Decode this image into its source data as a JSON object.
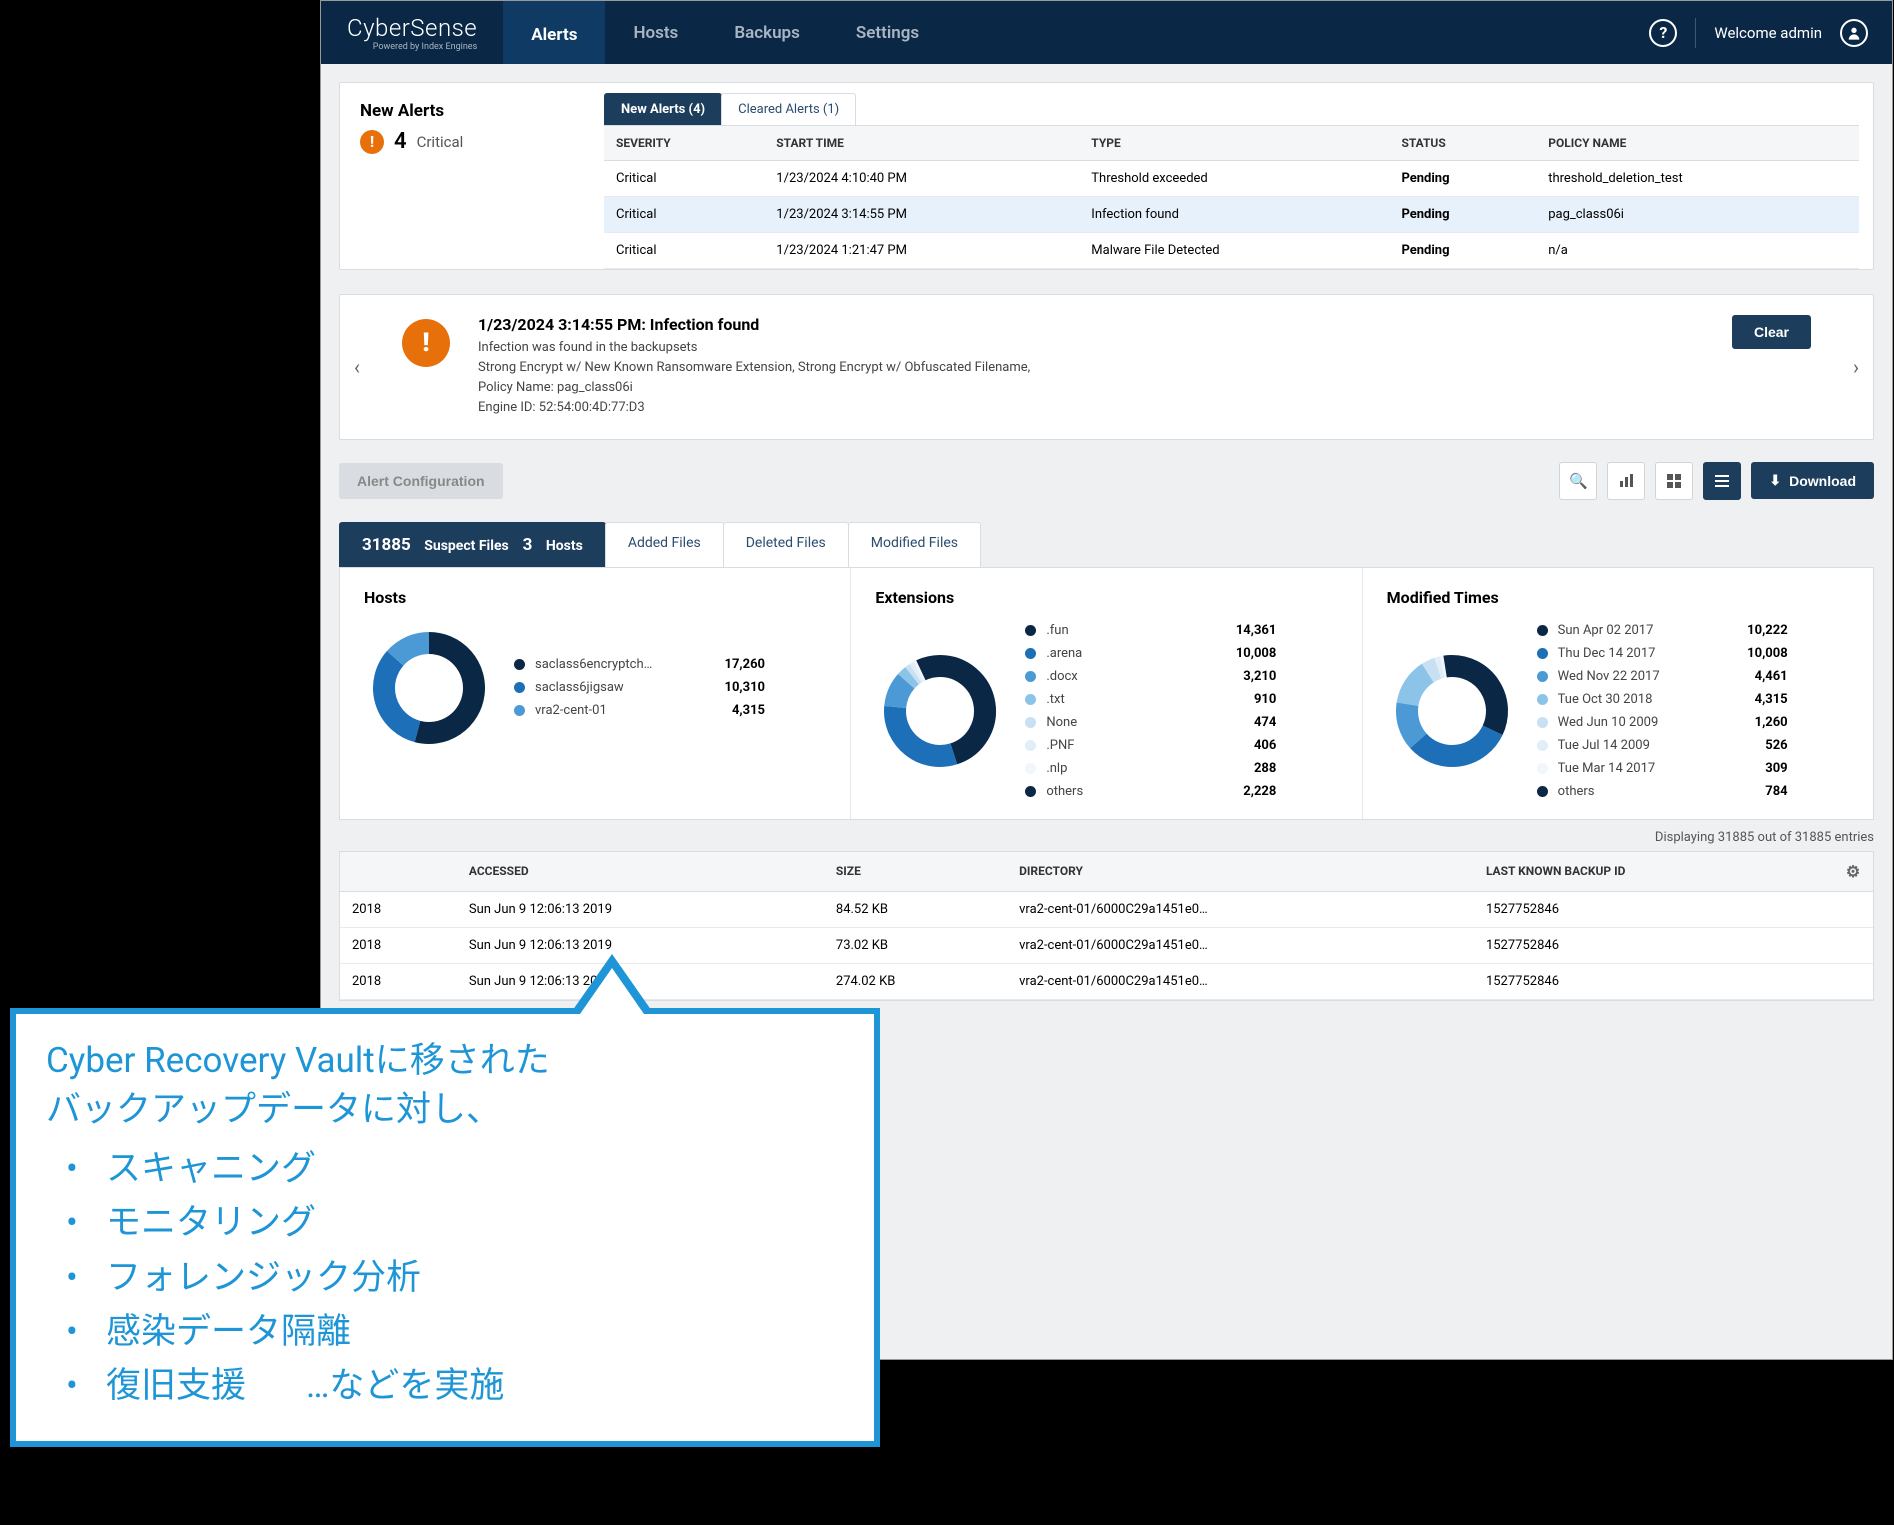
{
  "app": {
    "name": "CyberSense",
    "tagline": "Powered by Index Engines",
    "nav": [
      "Alerts",
      "Hosts",
      "Backups",
      "Settings"
    ],
    "active_nav": 0,
    "welcome": "Welcome admin"
  },
  "alerts_panel": {
    "title": "New Alerts",
    "count": "4",
    "severity_label": "Critical",
    "tabs": [
      "New Alerts (4)",
      "Cleared Alerts (1)"
    ],
    "columns": [
      "SEVERITY",
      "START TIME",
      "TYPE",
      "STATUS",
      "POLICY NAME"
    ],
    "rows": [
      {
        "sev": "Critical",
        "start": "1/23/2024 4:10:40 PM",
        "type": "Threshold exceeded",
        "status": "Pending",
        "policy": "threshold_deletion_test",
        "hl": false
      },
      {
        "sev": "Critical",
        "start": "1/23/2024 3:14:55 PM",
        "type": "Infection found",
        "status": "Pending",
        "policy": "pag_class06i",
        "hl": true
      },
      {
        "sev": "Critical",
        "start": "1/23/2024 1:21:47 PM",
        "type": "Malware File Detected",
        "status": "Pending",
        "policy": "n/a",
        "hl": false
      }
    ]
  },
  "detail": {
    "title": "1/23/2024 3:14:55 PM: Infection found",
    "lines": [
      "Infection was found in the backupsets",
      "Strong Encrypt w/ New Known Ransomware Extension, Strong Encrypt w/ Obfuscated Filename,",
      "Policy Name: pag_class06i",
      "Engine ID: 52:54:00:4D:77:D3"
    ],
    "clear": "Clear"
  },
  "toolbar": {
    "config": "Alert Configuration",
    "download": "Download"
  },
  "file_section": {
    "count": "31885",
    "suspect_label": "Suspect Files",
    "hosts_count": "3",
    "hosts_label": "Hosts",
    "tabs": [
      "Added Files",
      "Deleted Files",
      "Modified Files"
    ]
  },
  "display_info": "Displaying 31885 out of 31885 entries",
  "chart_data": [
    {
      "type": "pie",
      "title": "Hosts",
      "series": [
        {
          "name": "saclass6encryptch…",
          "value": 17260,
          "color": "#0a2845"
        },
        {
          "name": "saclass6jigsaw",
          "value": 10310,
          "color": "#1d6fb8"
        },
        {
          "name": "vra2-cent-01",
          "value": 4315,
          "color": "#4b9ad6"
        }
      ]
    },
    {
      "type": "pie",
      "title": "Extensions",
      "series": [
        {
          "name": ".fun",
          "value": 14361,
          "color": "#0a2845"
        },
        {
          "name": ".arena",
          "value": 10008,
          "color": "#1d6fb8"
        },
        {
          "name": ".docx",
          "value": 3210,
          "color": "#4b9ad6"
        },
        {
          "name": ".txt",
          "value": 910,
          "color": "#8cc3e8"
        },
        {
          "name": "None",
          "value": 474,
          "color": "#c7e0f2"
        },
        {
          "name": ".PNF",
          "value": 406,
          "color": "#e1eef8"
        },
        {
          "name": ".nlp",
          "value": 288,
          "color": "#f0f6fb"
        },
        {
          "name": "others",
          "value": 2228,
          "color": "#0a2845"
        }
      ]
    },
    {
      "type": "pie",
      "title": "Modified Times",
      "series": [
        {
          "name": "Sun Apr 02 2017",
          "value": 10222,
          "color": "#0a2845"
        },
        {
          "name": "Thu Dec 14 2017",
          "value": 10008,
          "color": "#1d6fb8"
        },
        {
          "name": "Wed Nov 22 2017",
          "value": 4461,
          "color": "#4b9ad6"
        },
        {
          "name": "Tue Oct 30 2018",
          "value": 4315,
          "color": "#8cc3e8"
        },
        {
          "name": "Wed Jun 10 2009",
          "value": 1260,
          "color": "#c7e0f2"
        },
        {
          "name": "Tue Jul 14 2009",
          "value": 526,
          "color": "#e1eef8"
        },
        {
          "name": "Tue Mar 14 2017",
          "value": 309,
          "color": "#f0f6fb"
        },
        {
          "name": "others",
          "value": 784,
          "color": "#0a2845"
        }
      ]
    }
  ],
  "file_table": {
    "columns": [
      "ACCESSED",
      "SIZE",
      "DIRECTORY",
      "LAST KNOWN BACKUP ID"
    ],
    "rows": [
      {
        "mod": "2018",
        "acc": "Sun Jun 9 12:06:13 2019",
        "size": "84.52 KB",
        "dir": "vra2-cent-01/6000C29a1451e0…",
        "bk": "1527752846"
      },
      {
        "mod": "2018",
        "acc": "Sun Jun 9 12:06:13 2019",
        "size": "73.02 KB",
        "dir": "vra2-cent-01/6000C29a1451e0…",
        "bk": "1527752846"
      },
      {
        "mod": "2018",
        "acc": "Sun Jun 9 12:06:13 2019",
        "size": "274.02 KB",
        "dir": "vra2-cent-01/6000C29a1451e0…",
        "bk": "1527752846"
      }
    ]
  },
  "callout": {
    "heading1": "Cyber Recovery Vaultに移された",
    "heading2": "バックアップデータに対し、",
    "items": [
      "スキャニング",
      "モニタリング",
      "フォレンジック分析",
      "感染データ隔離"
    ],
    "last": "復旧支援",
    "tail": "…などを実施"
  }
}
